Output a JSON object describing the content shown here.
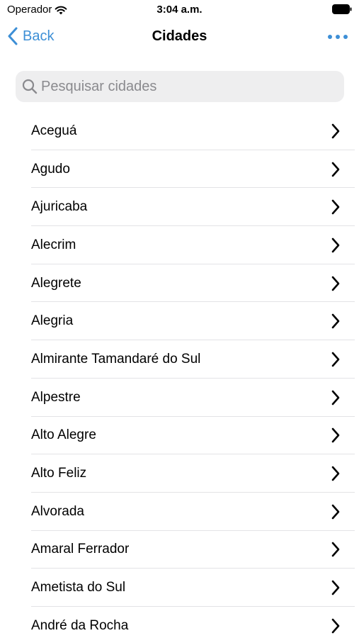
{
  "status_bar": {
    "carrier": "Operador",
    "time": "3:04 a.m."
  },
  "nav": {
    "back_label": "Back",
    "title": "Cidades"
  },
  "search": {
    "placeholder": "Pesquisar cidades",
    "value": ""
  },
  "cities": [
    "Aceguá",
    "Agudo",
    "Ajuricaba",
    "Alecrim",
    "Alegrete",
    "Alegria",
    "Almirante Tamandaré do Sul",
    "Alpestre",
    "Alto Alegre",
    "Alto Feliz",
    "Alvorada",
    "Amaral Ferrador",
    "Ametista do Sul",
    "André da Rocha"
  ],
  "colors": {
    "accent": "#3d8fd6",
    "search_bg": "#eeeeef",
    "separator": "#e3e3e6"
  }
}
